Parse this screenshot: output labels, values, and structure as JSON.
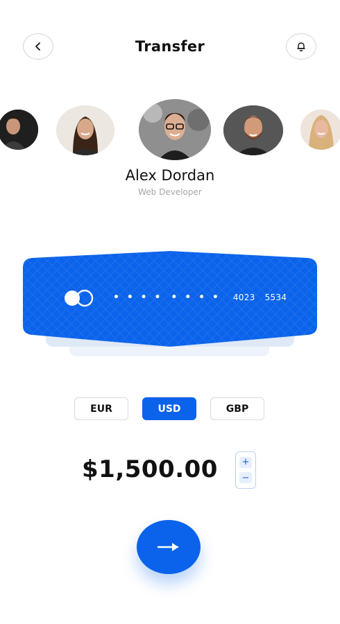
{
  "header": {
    "title": "Transfer",
    "back_icon": "chevron-left-icon",
    "bell_icon": "bell-icon"
  },
  "contacts": [
    {
      "id": "contact-1",
      "icon": "avatar-photo"
    },
    {
      "id": "contact-2",
      "icon": "avatar-photo"
    },
    {
      "id": "contact-3",
      "icon": "avatar-photo",
      "selected": true
    },
    {
      "id": "contact-4",
      "icon": "avatar-photo"
    },
    {
      "id": "contact-5",
      "icon": "avatar-photo"
    }
  ],
  "selected_contact": {
    "name": "Alex Dordan",
    "role": "Web Developer"
  },
  "card": {
    "masked_group_1": "• • • •",
    "masked_group_2": "• • • •",
    "group_3": "4023",
    "group_4": "5534",
    "brand_icon": "card-brand-logo-icon",
    "color": "#0a63ea"
  },
  "currencies": [
    {
      "label": "EUR",
      "selected": false
    },
    {
      "label": "USD",
      "selected": true
    },
    {
      "label": "GBP",
      "selected": false
    }
  ],
  "amount": "$1,500.00",
  "stepper": {
    "plus": "+",
    "minus": "−"
  },
  "colors": {
    "accent": "#0a63ea",
    "text": "#111111",
    "muted": "#a5a5a5"
  }
}
